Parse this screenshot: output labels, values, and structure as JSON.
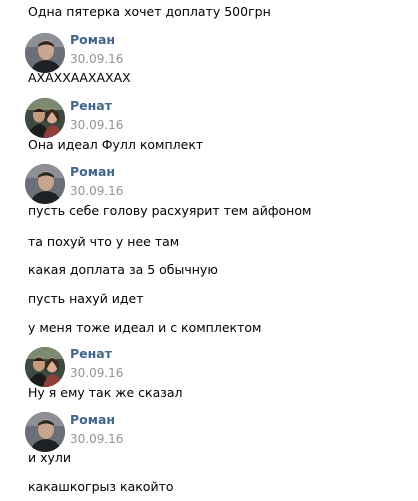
{
  "messages": {
    "m0": "Одна пятерка хочет доплату 500грн",
    "m1": "АХАХХААХАХАХ",
    "m2": "Она идеал Фулл комплект",
    "m3": "пусть себе голову расхуярит тем айфоном",
    "m4": "та похуй что у нее там",
    "m5": "какая доплата за 5 обычную",
    "m6": "пусть нахуй идет",
    "m7": "у меня тоже идеал и с комплектом",
    "m8": "Ну я ему так же сказал",
    "m9": "и хули",
    "m10": "какашкогрыз какойто"
  },
  "groups": {
    "g1": {
      "author": "Роман",
      "date": "30.09.16"
    },
    "g2": {
      "author": "Ренат",
      "date": "30.09.16"
    },
    "g3": {
      "author": "Роман",
      "date": "30.09.16"
    },
    "g4": {
      "author": "Ренат",
      "date": "30.09.16"
    },
    "g5": {
      "author": "Роман",
      "date": "30.09.16"
    }
  },
  "colors": {
    "author_link": "#42648b",
    "date_text": "#939393",
    "message_text": "#000000"
  },
  "icons": {
    "avatar_roman": "avatar-photo-roman",
    "avatar_renat": "avatar-photo-renat"
  }
}
